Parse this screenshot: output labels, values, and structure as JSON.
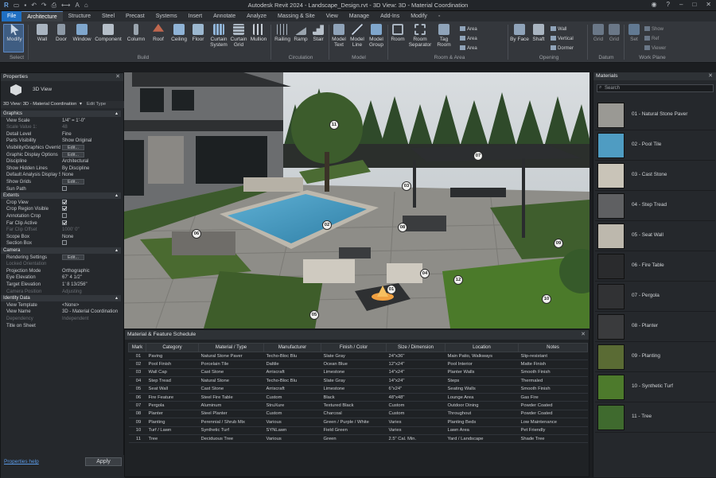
{
  "title": "Autodesk Revit 2024 - Landscape_Design.rvt - 3D View: 3D - Material Coordination",
  "tabs": [
    "File",
    "Architecture",
    "Structure",
    "Steel",
    "Precast",
    "Systems",
    "Insert",
    "Annotate",
    "Analyze",
    "Massing & Site",
    "View",
    "Manage",
    "Add-Ins",
    "Modify"
  ],
  "active_tab": "Architecture",
  "ribbon": {
    "buttons": [
      "Modify",
      "Wall",
      "Door",
      "Window",
      "Component",
      "Column",
      "Roof",
      "Ceiling",
      "Floor",
      "Curtain System",
      "Curtain Grid",
      "Mullion",
      "Railing",
      "Ramp",
      "Stair",
      "Model Text",
      "Model Line",
      "Model Group",
      "Room",
      "Room Separator",
      "Tag Room",
      "By Face",
      "Shaft",
      "Set",
      "Show"
    ],
    "small": [
      "Area",
      "Area",
      "Area",
      "Wall",
      "Vertical",
      "Dormer",
      "Grid",
      "Ref",
      "Viewer"
    ],
    "groups": [
      "Select",
      "Build",
      "Circulation",
      "Model",
      "Room & Area",
      "Opening",
      "Datum",
      "Work Plane"
    ]
  },
  "properties": {
    "title": "Properties",
    "type_name": "3D View",
    "selector": "3D View: 3D - Material Coordination",
    "edit_type": "Edit Type",
    "rows": [
      {
        "k": "Graphics",
        "sec": true
      },
      {
        "k": "View Scale",
        "v": "1/4\" = 1'-0\""
      },
      {
        "k": "Scale Value   1:",
        "v": "48",
        "dim": true
      },
      {
        "k": "Detail Level",
        "v": "Fine"
      },
      {
        "k": "Parts Visibility",
        "v": "Show Original"
      },
      {
        "k": "Visibility/Graphics Overrides",
        "v": "Edit...",
        "btn": true
      },
      {
        "k": "Graphic Display Options",
        "v": "Edit...",
        "btn": true
      },
      {
        "k": "Discipline",
        "v": "Architectural"
      },
      {
        "k": "Show Hidden Lines",
        "v": "By Discipline"
      },
      {
        "k": "Default Analysis Display Style",
        "v": "None"
      },
      {
        "k": "Show Grids",
        "v": "Edit...",
        "btn": true
      },
      {
        "k": "Sun Path",
        "chk": false
      },
      {
        "k": "Extents",
        "sec": true
      },
      {
        "k": "Crop View",
        "chk": true
      },
      {
        "k": "Crop Region Visible",
        "chk": true
      },
      {
        "k": "Annotation Crop",
        "chk": false
      },
      {
        "k": "Far Clip Active",
        "chk": true
      },
      {
        "k": "Far Clip Offset",
        "v": "1000' 0\"",
        "dim": true
      },
      {
        "k": "Scope Box",
        "v": "None"
      },
      {
        "k": "Section Box",
        "chk": false
      },
      {
        "k": "Camera",
        "sec": true
      },
      {
        "k": "Rendering Settings",
        "v": "Edit...",
        "btn": true
      },
      {
        "k": "Locked Orientation",
        "dim": true
      },
      {
        "k": "Projection Mode",
        "v": "Orthographic"
      },
      {
        "k": "Eye Elevation",
        "v": "67' 4 1/2\""
      },
      {
        "k": "Target Elevation",
        "v": "1' 8 13/256\""
      },
      {
        "k": "Camera Position",
        "v": "Adjusting",
        "dim": true
      },
      {
        "k": "Identity Data",
        "sec": true
      },
      {
        "k": "View Template",
        "v": "<None>"
      },
      {
        "k": "View Name",
        "v": "3D - Material Coordination"
      },
      {
        "k": "Dependency",
        "v": "Independent",
        "dim": true
      },
      {
        "k": "Title on Sheet",
        "v": ""
      }
    ],
    "help": "Properties help",
    "apply": "Apply"
  },
  "viewport": {
    "callouts": [
      "11",
      "07",
      "03",
      "02",
      "08",
      "06",
      "09",
      "05",
      "04",
      "01",
      "10",
      "12"
    ]
  },
  "schedule": {
    "title": "Material & Feature Schedule",
    "headers": [
      "Mark",
      "Category",
      "Material / Type",
      "Manufacturer",
      "Finish / Color",
      "Size / Dimension",
      "Location",
      "Notes"
    ],
    "rows": [
      [
        "01",
        "Paving",
        "Natural Stone Paver",
        "Techo-Bloc Blu",
        "Slate Gray",
        "24\"x36\"",
        "Main Patio, Walkways",
        "Slip-resistant"
      ],
      [
        "02",
        "Pool Finish",
        "Porcelain Tile",
        "Daltile",
        "Ocean Blue",
        "12\"x24\"",
        "Pool Interior",
        "Matte Finish"
      ],
      [
        "03",
        "Wall Cap",
        "Cast Stone",
        "Arriscraft",
        "Limestone",
        "14\"x24\"",
        "Planter Walls",
        "Smooth Finish"
      ],
      [
        "04",
        "Step Tread",
        "Natural Stone",
        "Techo-Bloc Blu",
        "Slate Gray",
        "14\"x24\"",
        "Steps",
        "Thermaled"
      ],
      [
        "05",
        "Seat Wall",
        "Cast Stone",
        "Arriscraft",
        "Limestone",
        "6\"x24\"",
        "Seating Walls",
        "Smooth Finish"
      ],
      [
        "06",
        "Fire Feature",
        "Steel Fire Table",
        "Custom",
        "Black",
        "48\"x48\"",
        "Lounge Area",
        "Gas Fire"
      ],
      [
        "07",
        "Pergola",
        "Aluminum",
        "StruXure",
        "Textured Black",
        "Custom",
        "Outdoor Dining",
        "Powder Coated"
      ],
      [
        "08",
        "Planter",
        "Steel Planter",
        "Custom",
        "Charcoal",
        "Custom",
        "Throughout",
        "Powder Coated"
      ],
      [
        "09",
        "Planting",
        "Perennial / Shrub Mix",
        "Various",
        "Green / Purple / White",
        "Varies",
        "Planting Beds",
        "Low Maintenance"
      ],
      [
        "10",
        "Turf / Lawn",
        "Synthetic Turf",
        "SYNLawn",
        "Field Green",
        "Varies",
        "Lawn Area",
        "Pet Friendly"
      ],
      [
        "11",
        "Tree",
        "Deciduous Tree",
        "Various",
        "Green",
        "2.5\" Cal. Min.",
        "Yard / Landscape",
        "Shade Tree"
      ]
    ]
  },
  "materials": {
    "title": "Materials",
    "search_placeholder": "Search",
    "items": [
      {
        "name": "01 - Natural Stone Paver",
        "color": "#9a9994"
      },
      {
        "name": "02 - Pool Tile",
        "color": "#4f9cc2"
      },
      {
        "name": "03 - Cast Stone",
        "color": "#c9c4b8"
      },
      {
        "name": "04 - Step Tread",
        "color": "#5f6062"
      },
      {
        "name": "05 - Seat Wall",
        "color": "#bdb8ad"
      },
      {
        "name": "06 - Fire Table",
        "color": "#2a2b2d"
      },
      {
        "name": "07 - Pergola",
        "color": "#313234"
      },
      {
        "name": "08 - Planter",
        "color": "#3a3b3d"
      },
      {
        "name": "09 - Planting",
        "color": "#5a6b34"
      },
      {
        "name": "10 - Synthetic Turf",
        "color": "#4d7a2c"
      },
      {
        "name": "11 - Tree",
        "color": "#3f6a2e"
      }
    ]
  }
}
